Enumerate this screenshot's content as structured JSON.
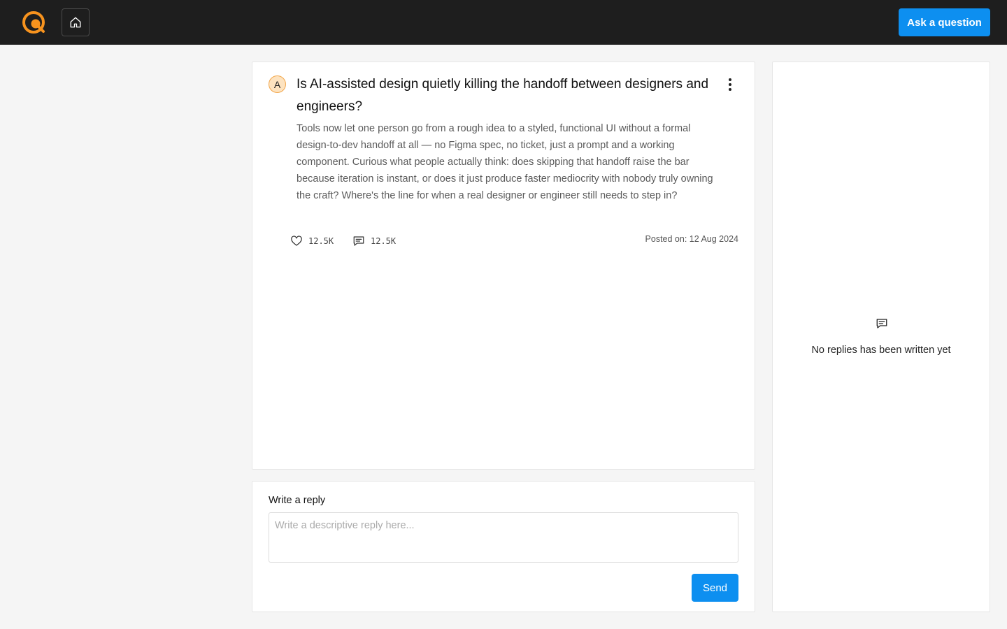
{
  "header": {
    "ask_label": "Ask a question",
    "accent": "#0d8ff0",
    "logo_color": "#f7931e",
    "icons": {
      "home": "home-icon"
    }
  },
  "question": {
    "avatar_letter": "A",
    "title": "Is AI-assisted design quietly killing the handoff between designers and engineers?",
    "body": "Tools now let one person go from a rough idea to a styled, functional UI without a formal design-to-dev handoff at all — no Figma spec, no ticket, just a prompt and a working component. Curious what people actually think: does skipping that handoff raise the bar because iteration is instant, or does it just produce faster mediocrity with nobody truly owning the craft? Where's the line for when a real designer or engineer still needs to step in?",
    "likes": "12.5K",
    "comments": "12.5K",
    "posted": "Posted on: 12 Aug 2024",
    "icons": {
      "like": "heart-icon",
      "comment": "comment-icon",
      "menu": "more-vertical-icon"
    }
  },
  "reply": {
    "label": "Write a reply",
    "placeholder": "Write a descriptive reply here...",
    "value": "",
    "send_label": "Send"
  },
  "replies": {
    "empty_text": "No replies has been written yet",
    "icon": "comment-icon"
  }
}
